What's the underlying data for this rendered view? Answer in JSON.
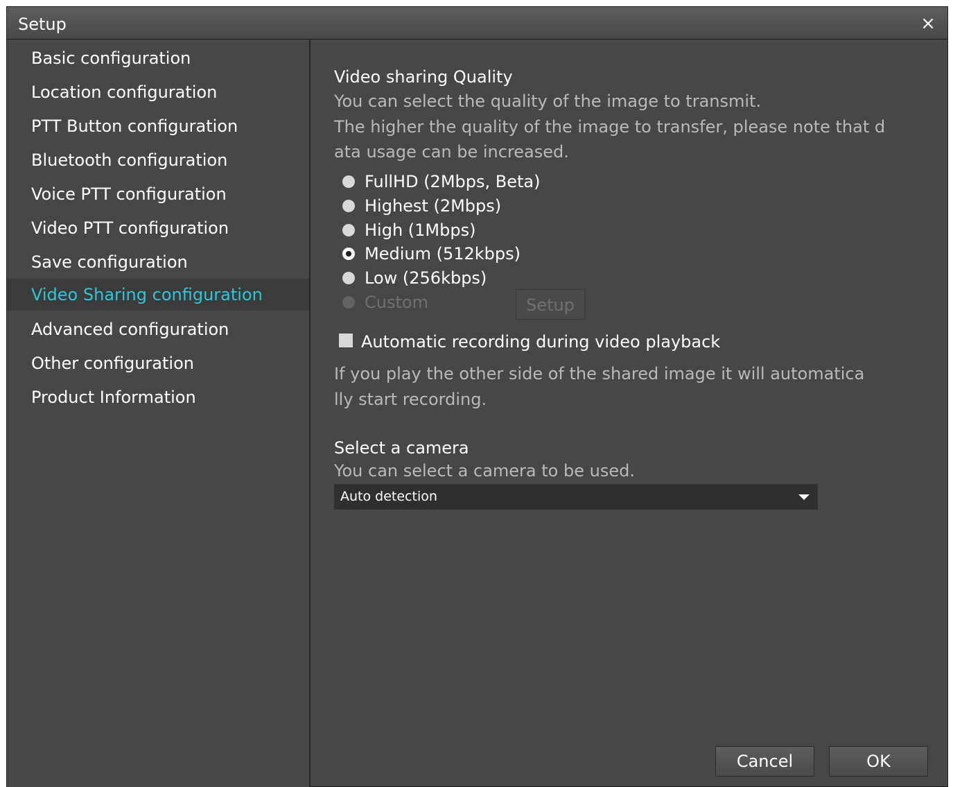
{
  "window": {
    "title": "Setup",
    "close_glyph": "×"
  },
  "sidebar": {
    "items": [
      {
        "label": "Basic configuration"
      },
      {
        "label": "Location configuration"
      },
      {
        "label": "PTT Button configuration"
      },
      {
        "label": "Bluetooth configuration"
      },
      {
        "label": "Voice PTT configuration"
      },
      {
        "label": "Video PTT configuration"
      },
      {
        "label": "Save configuration"
      },
      {
        "label": "Video Sharing configuration",
        "active": true
      },
      {
        "label": "Advanced configuration"
      },
      {
        "label": "Other configuration"
      },
      {
        "label": "Product Information"
      }
    ]
  },
  "quality": {
    "heading": "Video sharing Quality",
    "desc_line1": "You can select the quality of the image to transmit.",
    "desc_line2": "The higher the quality of the image to transfer, please note that d",
    "desc_line3": "ata usage can be increased.",
    "options": [
      {
        "label": "FullHD (2Mbps, Beta)",
        "checked": false,
        "disabled": false
      },
      {
        "label": "Highest (2Mbps)",
        "checked": false,
        "disabled": false
      },
      {
        "label": "High (1Mbps)",
        "checked": false,
        "disabled": false
      },
      {
        "label": "Medium (512kbps)",
        "checked": true,
        "disabled": false
      },
      {
        "label": "Low (256kbps)",
        "checked": false,
        "disabled": false
      },
      {
        "label": "Custom",
        "checked": false,
        "disabled": true
      }
    ],
    "setup_button": "Setup"
  },
  "recording": {
    "label": "Automatic recording during video playback",
    "checked": false,
    "desc_line1": "If you play the other side of the shared image it will automatica",
    "desc_line2": "lly start recording."
  },
  "camera": {
    "heading": "Select a camera",
    "desc": "You can select a camera to be used.",
    "selected": "Auto detection"
  },
  "footer": {
    "cancel": "Cancel",
    "ok": "OK"
  },
  "colors": {
    "accent": "#2fc6d8",
    "panel": "#474747",
    "selected_row": "#3b3b3b"
  }
}
